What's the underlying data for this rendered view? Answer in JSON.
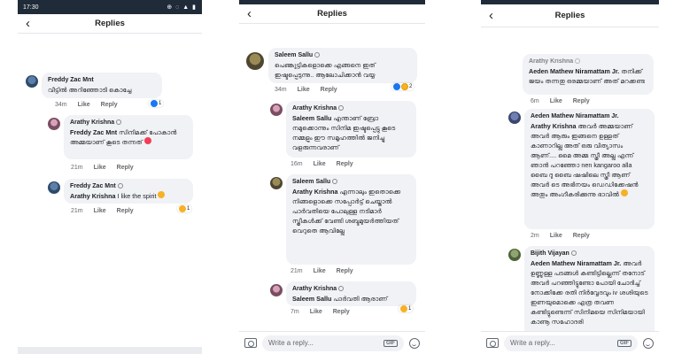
{
  "status_bar": {
    "time": "17:30",
    "icons_right": "⊕ ◌ ▲ ▮"
  },
  "header": {
    "title": "Replies",
    "back_icon": "arrow-left-icon"
  },
  "actions": {
    "like": "Like",
    "reply": "Reply"
  },
  "composer": {
    "placeholder": "Write a reply...",
    "gif_label": "GIF"
  },
  "panel1": {
    "comments": [
      {
        "name": "Freddy Zac Mnt",
        "text": "വീട്ടിൽ അറിഞ്ഞോടി കൊച്ചേ",
        "time": "34m",
        "reaction_count": "1"
      },
      {
        "name": "Arathy Krishna",
        "tag": "Freddy Zac Mnt",
        "text": " സിനിമക്ക് പോകാൻ അമ്മയാണ് കൂടെ തന്നത്",
        "time": "21m"
      },
      {
        "name": "Freddy Zac Mnt",
        "tag": "Arathy Krishna",
        "text": " I like the spirit",
        "time": "21m",
        "reaction_count": "1"
      }
    ]
  },
  "panel2": {
    "comments": [
      {
        "name": "Saleem Sallu",
        "text": "പെണ്കുട്ടികളൊക്കെ എങ്ങനെ ഇത് ഇഷ്ടപ്പെടുന്നു.. ആലോചിക്കാൻ വയ്യ",
        "time": "34m",
        "reaction_count": "2"
      },
      {
        "name": "Arathy Krishna",
        "tag": "Saleem Sallu",
        "text": " എന്താണ് ബ്രോ നമുക്കൊന്നും സിനിമ ഇഷ്ടപ്പെട്ടു കൂടെ നമ്മളും ഈ സമൂഹത്തിൽ ജനിച്ചു വളരുന്നവരാണ്",
        "time": "16m"
      },
      {
        "name": "Saleem Sallu",
        "tag": "Arathy Krishna",
        "text": " എന്നാലും ഇതൊക്കെ നിങ്ങളൊക്കെ സപ്പോർട്ട് ചെയ്താൽ പാർവതിയെ പോലുള്ള നടിമാർ സ്ത്രീകൾക്ക് വേണ്ടി ശബ്ദമുയർത്തിയത് വെറുതെ ആവില്ലേ",
        "time": "21m"
      },
      {
        "name": "Arathy Krishna",
        "tag": "Saleem Sallu",
        "text": " പാർവതി ആരാണ്",
        "time": "7m",
        "reaction_count": "1"
      }
    ]
  },
  "panel3": {
    "comments": [
      {
        "name": "Arathy Krishna",
        "tag": "Aeden Mathew Niramattam Jr.",
        "text": " തനിക്ക് ജയം തന്നതു ഒരമ്മയാണ് അത് മറക്കണ്ട",
        "time": "6m"
      },
      {
        "name": "Aeden Mathew Niramattam Jr.",
        "tag": "Arathy Krishna",
        "text": " അവർ അമ്മയാണ് അവർ ആരും ഇങ്ങനെ ഉള്ളത് കാണാറില്ല അത് ഒരു വിത്യാസം ആണ്.... മൈ അമ്മ സ്ത്രീ അല്ല എന്ന് ഞാൻ പറഞ്ഞോ nen kangaroo alla ബൈ ദു ബൈ ഷഷിലെ സ്ത്രീ ആണ് അവർ ടെ അഭിനയം ഡെഡിക്കേഷൻ അതും അംഗീകരിക്കുന്നു ഭാവിൽ",
        "time": "2m"
      },
      {
        "name": "Bijith Vijayan",
        "tag": "Aeden Mathew Niramattam Jr.",
        "text": " അവർ ഉണ്ണുള്ള പടങ്ങൾ കണ്ടിട്ടില്ലെന്ന് തനോട് അവർ പറഞ്ഞിട്ടുണ്ടോ പോയി ചോദിച്ച് നോക്കിക്കേ രതി നിർവ്വേദവും iv ശശിയുടെ ഇണയുമൊക്കെ എത്ര തവണ കണ്ടിട്ടുണ്ടെന്ന് സിനിമയെ സിനിമയായി കാണൂ സഹോദരി"
      }
    ]
  }
}
